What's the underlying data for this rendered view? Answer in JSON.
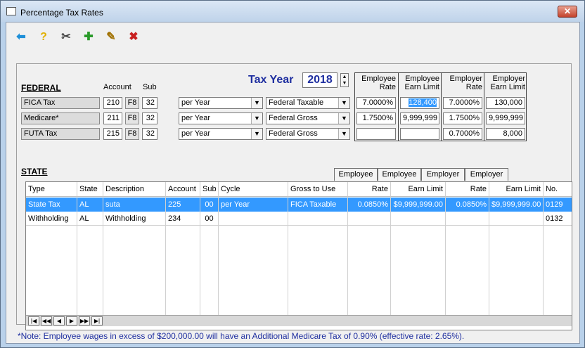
{
  "window": {
    "title": "Percentage Tax Rates",
    "close": "✕"
  },
  "toolbar": {
    "back": "⬅",
    "help": "?",
    "tools": "✂",
    "add": "✚",
    "edit": "✎",
    "delete": "✖"
  },
  "federal": {
    "heading": "FEDERAL",
    "account_label": "Account",
    "sub_label": "Sub",
    "tax_year_label": "Tax Year",
    "tax_year": "2018",
    "col_emp_rate": [
      "Employee",
      "Rate"
    ],
    "col_emp_limit": [
      "Employee",
      "Earn Limit"
    ],
    "col_er_rate": [
      "Employer",
      "Rate"
    ],
    "col_er_limit": [
      "Employer",
      "Earn Limit"
    ],
    "f8": "F8",
    "rows": [
      {
        "name": "FICA Tax",
        "account": "210",
        "sub": "32",
        "cycle": "per Year",
        "gross": "Federal Taxable",
        "emp_rate": "7.0000%",
        "emp_limit": "128,400",
        "er_rate": "7.0000%",
        "er_limit": "130,000"
      },
      {
        "name": "Medicare*",
        "account": "211",
        "sub": "32",
        "cycle": "per Year",
        "gross": "Federal Gross",
        "emp_rate": "1.7500%",
        "emp_limit": "9,999,999",
        "er_rate": "1.7500%",
        "er_limit": "9,999,999"
      },
      {
        "name": "FUTA Tax",
        "account": "215",
        "sub": "32",
        "cycle": "per Year",
        "gross": "Federal Gross",
        "emp_rate": "",
        "emp_limit": "",
        "er_rate": "0.7000%",
        "er_limit": "8,000"
      }
    ]
  },
  "state": {
    "heading": "STATE",
    "tabs": [
      "Employee",
      "Employee",
      "Employer",
      "Employer"
    ],
    "columns": [
      "Type",
      "State",
      "Description",
      "Account",
      "Sub",
      "Cycle",
      "Gross to Use",
      "Rate",
      "Earn Limit",
      "Rate",
      "Earn Limit",
      "No."
    ],
    "rows": [
      [
        "State Tax",
        "AL",
        "suta",
        "225",
        "00",
        "per Year",
        "FICA Taxable",
        "0.0850%",
        "$9,999,999.00",
        "0.0850%",
        "$9,999,999.00",
        "0129"
      ],
      [
        "Withholding",
        "AL",
        "Withholding",
        "234",
        "00",
        "",
        "",
        "",
        "",
        "",
        "",
        "0132"
      ]
    ],
    "nav": [
      "|◀",
      "◀◀",
      "◀",
      "▶",
      "▶▶",
      "▶|"
    ]
  },
  "note": "*Note: Employee wages in excess of $200,000.00 will have an Additional Medicare Tax of 0.90% (effective rate: 2.65%).",
  "colors": {
    "accent": "#1f2fa0",
    "selected_row": "#3399ff"
  }
}
